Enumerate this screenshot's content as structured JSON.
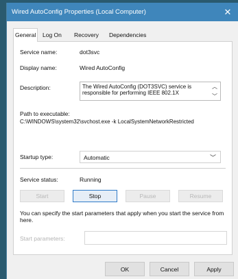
{
  "window": {
    "title": "Wired AutoConfig Properties (Local Computer)",
    "close_icon": "close-icon"
  },
  "tabs": [
    {
      "label": "General",
      "active": true
    },
    {
      "label": "Log On",
      "active": false
    },
    {
      "label": "Recovery",
      "active": false
    },
    {
      "label": "Dependencies",
      "active": false
    }
  ],
  "general": {
    "service_name_label": "Service name:",
    "service_name_value": "dot3svc",
    "display_name_label": "Display name:",
    "display_name_value": "Wired AutoConfig",
    "description_label": "Description:",
    "description_value": "The Wired AutoConfig (DOT3SVC) service is responsible for performing IEEE 802.1X",
    "path_label": "Path to executable:",
    "path_value": "C:\\WINDOWS\\system32\\svchost.exe -k LocalSystemNetworkRestricted",
    "startup_type_label": "Startup type:",
    "startup_type_value": "Automatic",
    "service_status_label": "Service status:",
    "service_status_value": "Running",
    "buttons": {
      "start": "Start",
      "stop": "Stop",
      "pause": "Pause",
      "resume": "Resume"
    },
    "note": "You can specify the start parameters that apply when you start the service from here.",
    "start_params_label": "Start parameters:",
    "start_params_value": ""
  },
  "footer": {
    "ok": "OK",
    "cancel": "Cancel",
    "apply": "Apply"
  },
  "colors": {
    "titlebar": "#3f86bb",
    "desktop": "#2a5a6f"
  }
}
